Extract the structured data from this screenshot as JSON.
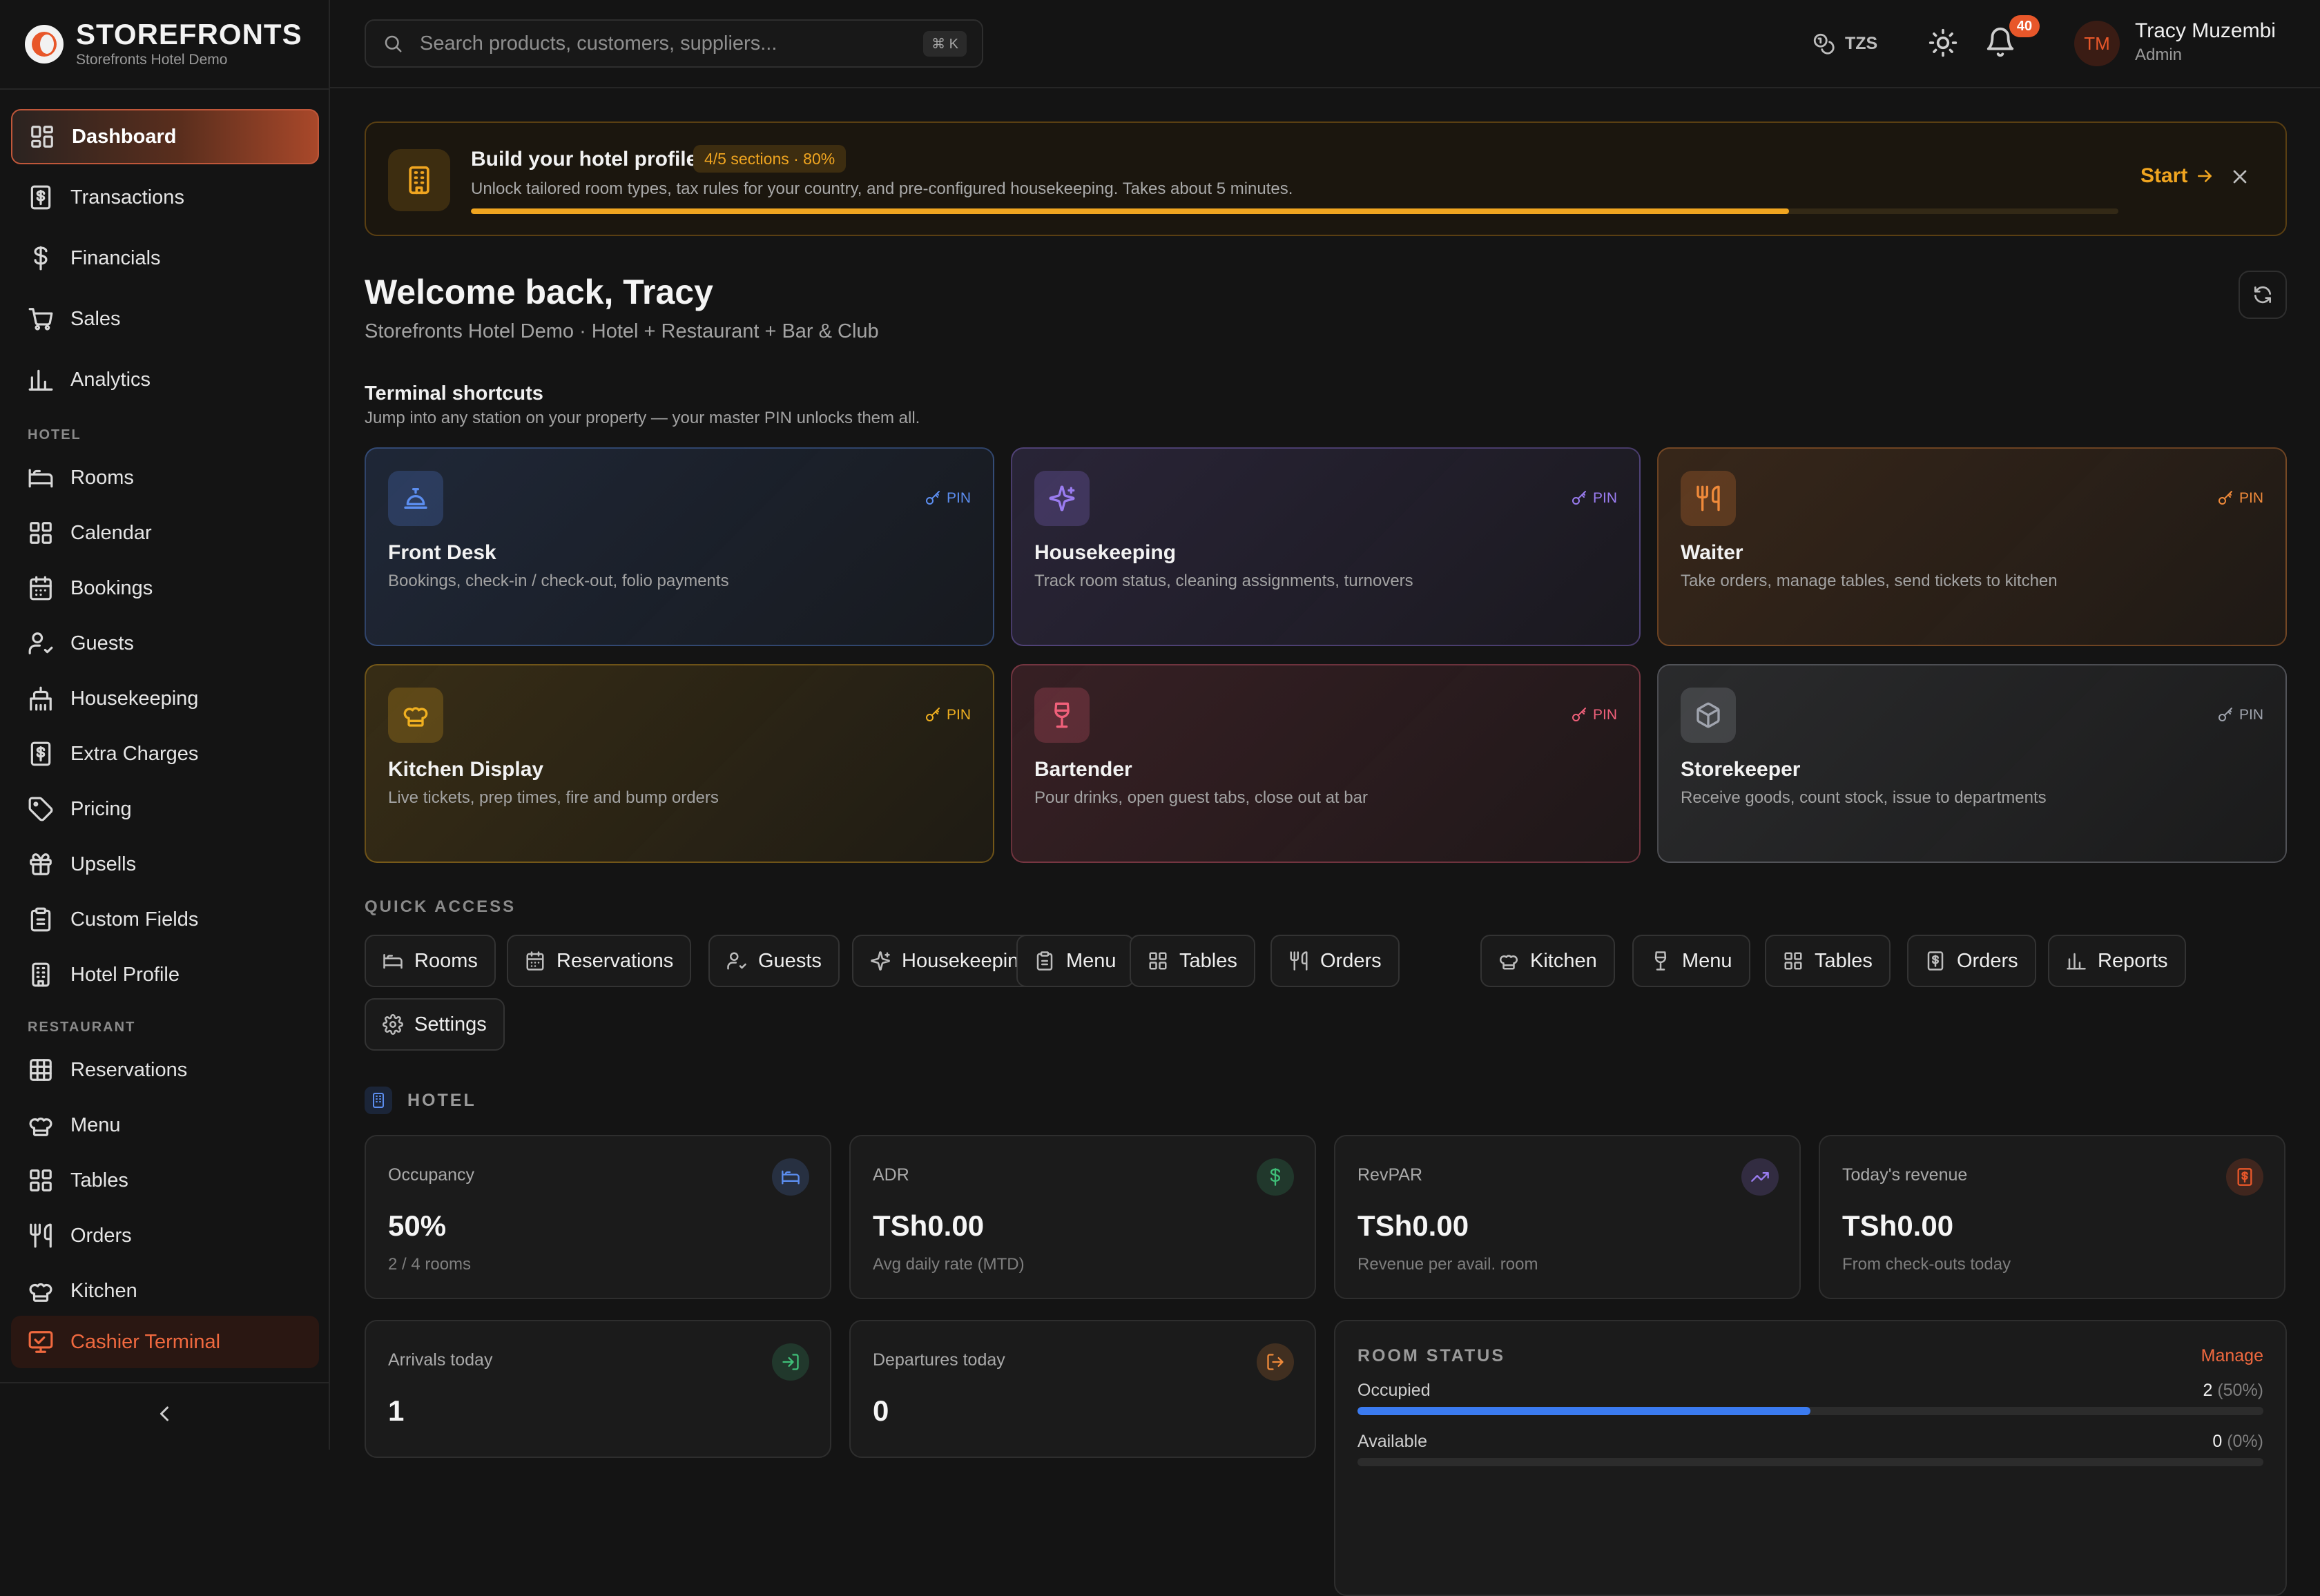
{
  "brand": {
    "name": "STOREFRONTS",
    "subtitle": "Storefronts Hotel Demo",
    "accent": "#e8572a"
  },
  "sidebar": {
    "main": [
      {
        "label": "Dashboard",
        "icon": "dashboard-icon",
        "active": true
      },
      {
        "label": "Transactions",
        "icon": "receipt-icon"
      },
      {
        "label": "Financials",
        "icon": "dollar-icon"
      },
      {
        "label": "Sales",
        "icon": "cart-icon"
      },
      {
        "label": "Analytics",
        "icon": "bar-chart-icon"
      }
    ],
    "hotel_section": "HOTEL",
    "hotel": [
      {
        "label": "Rooms",
        "icon": "bed-icon"
      },
      {
        "label": "Calendar",
        "icon": "grid-icon"
      },
      {
        "label": "Bookings",
        "icon": "calendar-icon"
      },
      {
        "label": "Guests",
        "icon": "user-check-icon"
      },
      {
        "label": "Housekeeping",
        "icon": "broom-icon"
      },
      {
        "label": "Extra Charges",
        "icon": "receipt-icon"
      },
      {
        "label": "Pricing",
        "icon": "tag-icon"
      },
      {
        "label": "Upsells",
        "icon": "gift-icon"
      },
      {
        "label": "Custom Fields",
        "icon": "clipboard-icon"
      },
      {
        "label": "Hotel Profile",
        "icon": "building-icon"
      }
    ],
    "restaurant_section": "RESTAURANT",
    "restaurant": [
      {
        "label": "Reservations",
        "icon": "table-icon"
      },
      {
        "label": "Menu",
        "icon": "chef-hat-icon"
      },
      {
        "label": "Tables",
        "icon": "grid-icon"
      },
      {
        "label": "Orders",
        "icon": "utensils-icon"
      },
      {
        "label": "Kitchen",
        "icon": "chef-hat-icon"
      }
    ],
    "cashier_label": "Cashier Terminal"
  },
  "topbar": {
    "search_placeholder": "Search products, customers, suppliers...",
    "shortcut": "⌘ K",
    "currency": "TZS",
    "notifications": "40",
    "user": {
      "initials": "TM",
      "name": "Tracy Muzembi",
      "role": "Admin"
    }
  },
  "banner": {
    "title": "Build your hotel profile",
    "pill": "4/5 sections · 80%",
    "description": "Unlock tailored room types, tax rules for your country, and pre-configured housekeeping. Takes about 5 minutes.",
    "progress": 0.8,
    "start_label": "Start",
    "accent": "#f0a520"
  },
  "welcome": {
    "title": "Welcome back, Tracy",
    "subtitle": "Storefronts Hotel Demo · Hotel + Restaurant + Bar & Club"
  },
  "terminals": {
    "title": "Terminal shortcuts",
    "subtitle": "Jump into any station on your property — your master PIN unlocks them all.",
    "pin_label": "PIN",
    "items": [
      {
        "name": "Front Desk",
        "description": "Bookings, check-in / check-out, folio payments",
        "icon": "bell-service-icon",
        "color": "#5c8ef0"
      },
      {
        "name": "Housekeeping",
        "description": "Track room status, cleaning assignments, turnovers",
        "icon": "sparkles-icon",
        "color": "#9a7cf0"
      },
      {
        "name": "Waiter",
        "description": "Take orders, manage tables, send tickets to kitchen",
        "icon": "utensils-icon",
        "color": "#f08a3a"
      },
      {
        "name": "Kitchen Display",
        "description": "Live tickets, prep times, fire and bump orders",
        "icon": "chef-hat-icon",
        "color": "#f0b020"
      },
      {
        "name": "Bartender",
        "description": "Pour drinks, open guest tabs, close out at bar",
        "icon": "wine-icon",
        "color": "#f0607a"
      },
      {
        "name": "Storekeeper",
        "description": "Receive goods, count stock, issue to departments",
        "icon": "box-icon",
        "color": "#a0a4ae"
      }
    ]
  },
  "quick_access": {
    "label": "QUICK ACCESS",
    "items": [
      {
        "label": "Rooms",
        "icon": "bed-icon"
      },
      {
        "label": "Reservations",
        "icon": "calendar-icon"
      },
      {
        "label": "Guests",
        "icon": "user-check-icon"
      },
      {
        "label": "Housekeeping",
        "icon": "sparkles-icon"
      },
      {
        "label": "Menu",
        "icon": "clipboard-icon"
      },
      {
        "label": "Tables",
        "icon": "grid-icon"
      },
      {
        "label": "Orders",
        "icon": "utensils-icon"
      },
      {
        "label": "Kitchen",
        "icon": "chef-hat-icon"
      },
      {
        "label": "Menu",
        "icon": "wine-icon"
      },
      {
        "label": "Tables",
        "icon": "grid-icon"
      },
      {
        "label": "Orders",
        "icon": "receipt-icon"
      },
      {
        "label": "Reports",
        "icon": "bar-chart-icon"
      },
      {
        "label": "Settings",
        "icon": "gear-icon"
      }
    ]
  },
  "hotel": {
    "label": "HOTEL",
    "kpis": [
      {
        "label": "Occupancy",
        "value": "50%",
        "sub": "2 / 4 rooms",
        "icon": "bed-icon",
        "color": "#5c8ef0"
      },
      {
        "label": "ADR",
        "value": "TSh0.00",
        "sub": "Avg daily rate (MTD)",
        "icon": "dollar-icon",
        "color": "#3fbf78"
      },
      {
        "label": "RevPAR",
        "value": "TSh0.00",
        "sub": "Revenue per avail. room",
        "icon": "trend-up-icon",
        "color": "#9a7cf0"
      },
      {
        "label": "Today's revenue",
        "value": "TSh0.00",
        "sub": "From check-outs today",
        "icon": "receipt-icon",
        "color": "#e8572a"
      }
    ],
    "arrivals": {
      "label": "Arrivals today",
      "value": "1",
      "icon": "log-in-icon",
      "color": "#3fbf78"
    },
    "departures": {
      "label": "Departures today",
      "value": "0",
      "icon": "log-out-icon",
      "color": "#f08a3a"
    },
    "room_status": {
      "title": "ROOM STATUS",
      "manage": "Manage",
      "rows": [
        {
          "label": "Occupied",
          "count": "2",
          "pct": "(50%)",
          "fraction": 0.5,
          "color": "#3b7bf0"
        },
        {
          "label": "Available",
          "count": "0",
          "pct": "(0%)",
          "fraction": 0,
          "color": "#3fbf78"
        }
      ]
    }
  }
}
